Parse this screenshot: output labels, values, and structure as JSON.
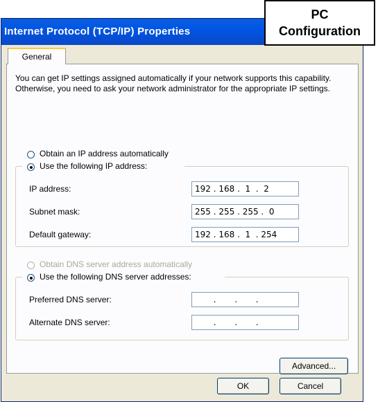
{
  "window": {
    "title": "Internet Protocol (TCP/IP) Properties"
  },
  "annotation": {
    "line1": "PC",
    "line2": "Configuration"
  },
  "tabs": [
    {
      "label": "General"
    }
  ],
  "intro_text": "You can get IP settings assigned automatically if your network supports this capability. Otherwise, you need to ask your network administrator for the appropriate IP settings.",
  "ip_mode": {
    "auto_label": "Obtain an IP address automatically",
    "manual_label": "Use the following IP address:",
    "selected": "manual"
  },
  "ip_fields": [
    {
      "label": "IP address:",
      "value": "192 . 168 .  1  .  2"
    },
    {
      "label": "Subnet mask:",
      "value": "255 . 255 . 255 .  0"
    },
    {
      "label": "Default gateway:",
      "value": "192 . 168 .  1  . 254"
    }
  ],
  "dns_mode": {
    "auto_label": "Obtain DNS server address automatically",
    "manual_label": "Use the following DNS server addresses:",
    "selected": "manual",
    "auto_disabled": true
  },
  "dns_fields": [
    {
      "label": "Preferred DNS server:",
      "value": "       .       .       ."
    },
    {
      "label": "Alternate DNS server:",
      "value": "       .       .       ."
    }
  ],
  "buttons": {
    "advanced": "Advanced...",
    "ok": "OK",
    "cancel": "Cancel"
  }
}
